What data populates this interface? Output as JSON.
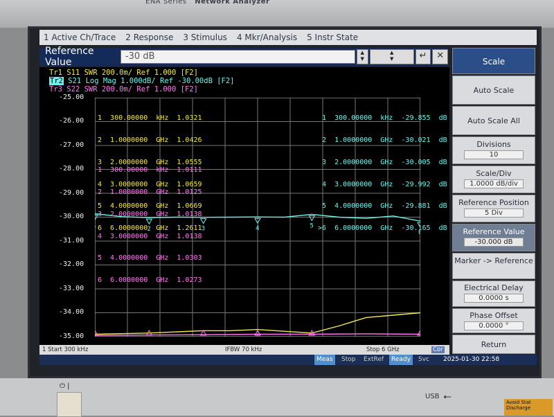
{
  "bezel": {
    "series": "ENA Series",
    "model": "Network Analyzer"
  },
  "menu": [
    "1 Active Ch/Trace",
    "2 Response",
    "3 Stimulus",
    "4 Mkr/Analysis",
    "5 Instr State"
  ],
  "entry": {
    "label": "Reference Value",
    "value": "-30 dB"
  },
  "traces": {
    "tr1": "Tr1  S11  SWR 200.0m/ Ref 1.000  [F2]",
    "tr2_tag": "Tr2",
    "tr2": " S21  Log Mag 1.000dB/ Ref -30.00dB  [F2]",
    "tr3": "Tr3  S22  SWR 200.0m/ Ref 1.000  [F2]"
  },
  "y_ticks": [
    "-25.00",
    "-26.00",
    "-27.00",
    "-28.00",
    "-29.00",
    "-30.00",
    "-31.00",
    "-32.00",
    "-33.00",
    "-34.00",
    "-35.00"
  ],
  "markers_tr1": [
    "1  300.00000  kHz  1.0321",
    "2  1.0000000  GHz  1.0426",
    "3  2.0000000  GHz  1.0555",
    "4  3.0000000  GHz  1.0659",
    "5  4.0000000  GHz  1.0669",
    "6  6.0000000  GHz  1.2611"
  ],
  "markers_tr3": [
    "1  300.00000  kHz  1.0111",
    "2  1.0000000  GHz  1.0125",
    "3  2.0000000  GHz  1.0138",
    "4  3.0000000  GHz  1.0138",
    "5  4.0000000  GHz  1.0303",
    "6  6.0000000  GHz  1.0273"
  ],
  "markers_tr2": [
    " 1  300.00000  kHz  -29.855  dB",
    " 2  1.0000000  GHz  -30.021  dB",
    " 3  2.0000000  GHz  -30.005  dB",
    " 4  3.0000000  GHz  -29.992  dB",
    " 5  4.0000000  GHz  -29.881  dB",
    ">6  6.0000000  GHz  -30.165  dB"
  ],
  "chart_data": {
    "type": "line",
    "x_unit": "GHz",
    "xlim": [
      0.0003,
      6
    ],
    "ylim": [
      -35,
      -25
    ],
    "series": [
      {
        "name": "S21",
        "color": "#6ff0e8",
        "x": [
          0.0003,
          0.5,
          1,
          1.5,
          2,
          2.5,
          3,
          3.5,
          4,
          4.5,
          5,
          5.5,
          6
        ],
        "y": [
          -29.855,
          -29.98,
          -30.021,
          -30.0,
          -30.005,
          -30.0,
          -29.992,
          -30.0,
          -29.881,
          -30.0,
          -30.05,
          -29.95,
          -30.165
        ]
      },
      {
        "name": "S11",
        "color": "#f4e84a",
        "x": [
          0.0003,
          1,
          2,
          2.5,
          3,
          4,
          4.5,
          5,
          5.5,
          6
        ],
        "y": [
          -34.9,
          -34.85,
          -34.75,
          -34.75,
          -34.7,
          -34.85,
          -34.55,
          -34.2,
          -34.1,
          -34.0
        ]
      },
      {
        "name": "S22",
        "color": "#ff7af0",
        "x": [
          0.0003,
          1,
          2,
          3,
          4,
          5,
          6
        ],
        "y": [
          -34.95,
          -34.93,
          -34.92,
          -34.9,
          -34.9,
          -34.88,
          -34.9
        ]
      }
    ],
    "marker_x": [
      0.0003,
      1,
      2,
      3,
      4,
      6
    ]
  },
  "status": {
    "start": "1  Start 300 kHz",
    "ifbw": "IFBW 70 kHz",
    "stop": "Stop 6 GHz",
    "cor": "Cor"
  },
  "statline": {
    "meas": "Meas",
    "stop": "Stop",
    "extref": "ExtRef",
    "ready": "Ready",
    "svc": "Svc",
    "datetime": "2025-01-30 22:58"
  },
  "softkeys": {
    "title": "Scale",
    "autoscale": "Auto Scale",
    "autoscale_all": "Auto Scale All",
    "divisions": "Divisions",
    "divisions_val": "10",
    "scalediv": "Scale/Div",
    "scalediv_val": "1.0000 dB/div",
    "refpos": "Reference Position",
    "refpos_val": "5 Div",
    "refval": "Reference Value",
    "refval_val": "-30.000 dB",
    "marker_ref": "Marker -> Reference",
    "edelay": "Electrical Delay",
    "edelay_val": "0.0000 s",
    "phase": "Phase Offset",
    "phase_val": "0.0000 °",
    "return": "Return"
  },
  "panel": {
    "usb": "USB",
    "warn": "Avoid Stat Discharge"
  }
}
